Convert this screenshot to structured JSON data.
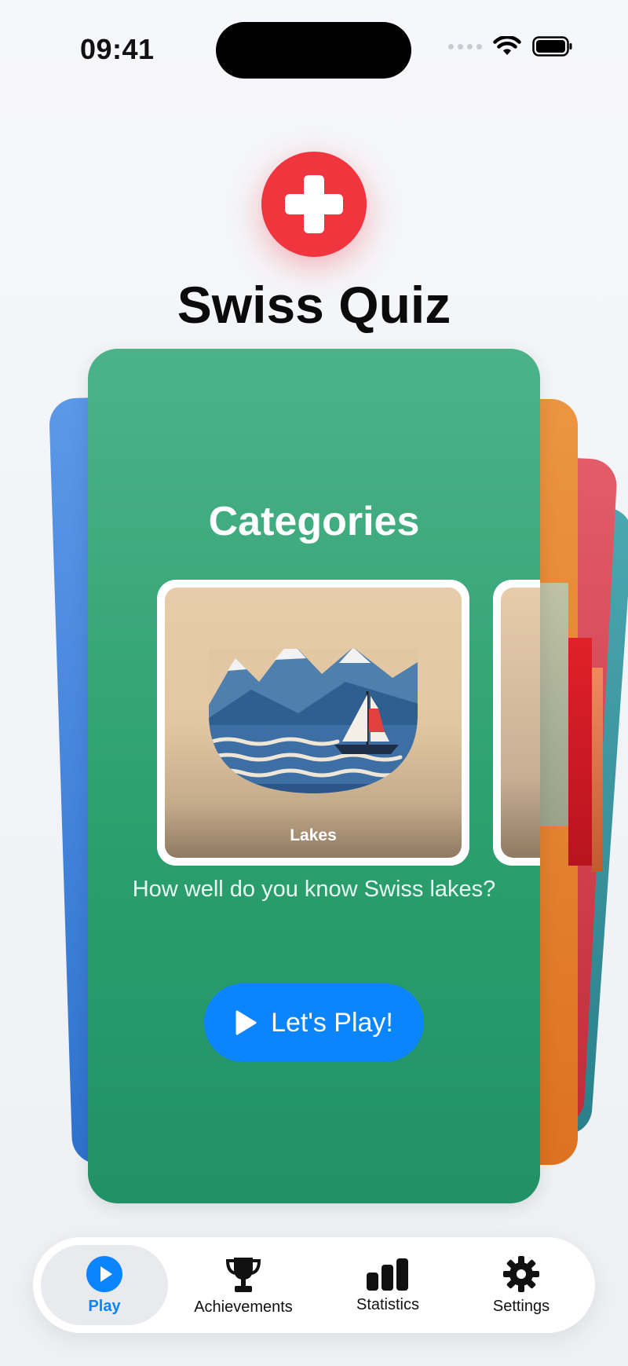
{
  "status_bar": {
    "time": "09:41"
  },
  "header": {
    "title": "Swiss Quiz"
  },
  "card": {
    "heading": "Categories",
    "tiles": [
      {
        "label": "Lakes"
      }
    ],
    "description": "How well do you know Swiss lakes?",
    "play_button": "Let's Play!"
  },
  "tab_bar": {
    "active": "Play",
    "tabs": [
      {
        "label": "Play",
        "icon": "play-circle-icon"
      },
      {
        "label": "Achievements",
        "icon": "trophy-icon"
      },
      {
        "label": "Statistics",
        "icon": "bar-chart-icon"
      },
      {
        "label": "Settings",
        "icon": "gear-icon"
      }
    ]
  },
  "colors": {
    "accent": "#0a84ff",
    "logo_red": "#f0353f",
    "card_green": "#2a9e6c",
    "card_blue": "#3b7fdc",
    "card_orange": "#e0781f",
    "card_red": "#d43a47",
    "card_teal": "#3a95a0"
  }
}
